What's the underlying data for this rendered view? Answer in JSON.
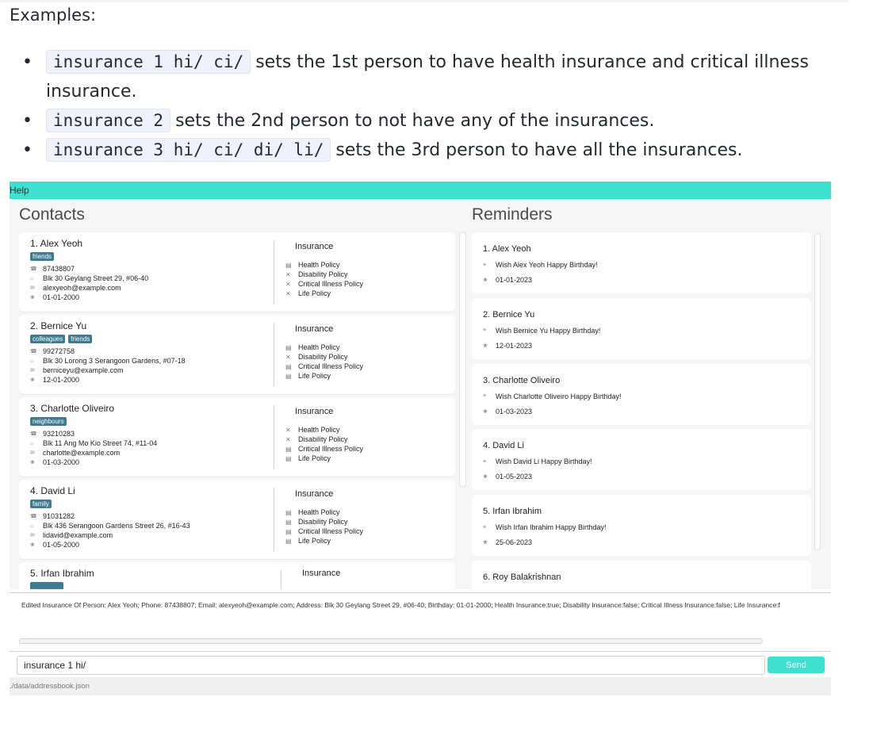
{
  "doc": {
    "examples_heading": "Examples:",
    "items": [
      {
        "code": "insurance 1 hi/ ci/",
        "text": "sets the 1st person to have health insurance and critical illness insurance."
      },
      {
        "code": "insurance 2",
        "text": "sets the 2nd person to not have any of the insurances."
      },
      {
        "code": "insurance 3 hi/ ci/ di/ li/",
        "text": "sets the 3rd person to have all the insurances."
      }
    ]
  },
  "app": {
    "menu_help": "Help",
    "contacts_title": "Contacts",
    "reminders_title": "Reminders",
    "insurance_heading": "Insurance",
    "policy_names": [
      "Health Policy",
      "Disability Policy",
      "Critical Illness Policy",
      "Life Policy"
    ],
    "contacts": [
      {
        "name": "1.  Alex Yeoh",
        "tags": [
          "friends"
        ],
        "phone": "87438807",
        "address": "Blk 30 Geylang Street 29, #06-40",
        "email": "alexyeoh@example.com",
        "birthday": "01-01-2000",
        "policies": [
          true,
          false,
          false,
          false
        ]
      },
      {
        "name": "2.  Bernice Yu",
        "tags": [
          "colleagues",
          "friends"
        ],
        "phone": "99272758",
        "address": "Blk 30 Lorong 3 Serangoon Gardens, #07-18",
        "email": "berniceyu@example.com",
        "birthday": "12-01-2000",
        "policies": [
          true,
          false,
          true,
          true
        ]
      },
      {
        "name": "3.  Charlotte Oliveiro",
        "tags": [
          "neighbours"
        ],
        "phone": "93210283",
        "address": "Blk 11 Ang Mo Kio Street 74, #11-04",
        "email": "charlotte@example.com",
        "birthday": "01-03-2000",
        "policies": [
          false,
          false,
          true,
          true
        ]
      },
      {
        "name": "4.  David Li",
        "tags": [
          "family"
        ],
        "phone": "91031282",
        "address": "Blk 436 Serangoon Gardens Street 26, #16-43",
        "email": "lidavid@example.com",
        "birthday": "01-05-2000",
        "policies": [
          true,
          true,
          true,
          true
        ]
      },
      {
        "name": "5.  Irfan Ibrahim",
        "tags": [],
        "phone": "",
        "address": "",
        "email": "",
        "birthday": "",
        "policies": []
      }
    ],
    "reminders": [
      {
        "name": "1.  Alex Yeoh",
        "message": "Wish Alex Yeoh Happy Birthday!",
        "date": "01-01-2023"
      },
      {
        "name": "2.  Bernice Yu",
        "message": "Wish Bernice Yu Happy Birthday!",
        "date": "12-01-2023"
      },
      {
        "name": "3.  Charlotte Oliveiro",
        "message": "Wish Charlotte Oliveiro Happy Birthday!",
        "date": "01-03-2023"
      },
      {
        "name": "4.  David Li",
        "message": "Wish David Li Happy Birthday!",
        "date": "01-05-2023"
      },
      {
        "name": "5.  Irfan Ibrahim",
        "message": "Wish Irfan Ibrahim Happy Birthday!",
        "date": "25-06-2023"
      },
      {
        "name": "6.  Roy Balakrishnan",
        "message": "",
        "date": ""
      }
    ],
    "result_message": "Edited Insurance Of Person: Alex Yeoh; Phone: 87438807; Email: alexyeoh@example.com; Address: Blk 30 Geylang Street 29, #06-40; Birthday: 01-01-2000; Health Insurance:true; Disability Insurance:false; Critical Illness Insurance:false; Life Insurance:f",
    "command_value": "insurance 1 hi/",
    "send_label": "Send",
    "status_path": "./data/addressbook.json"
  }
}
